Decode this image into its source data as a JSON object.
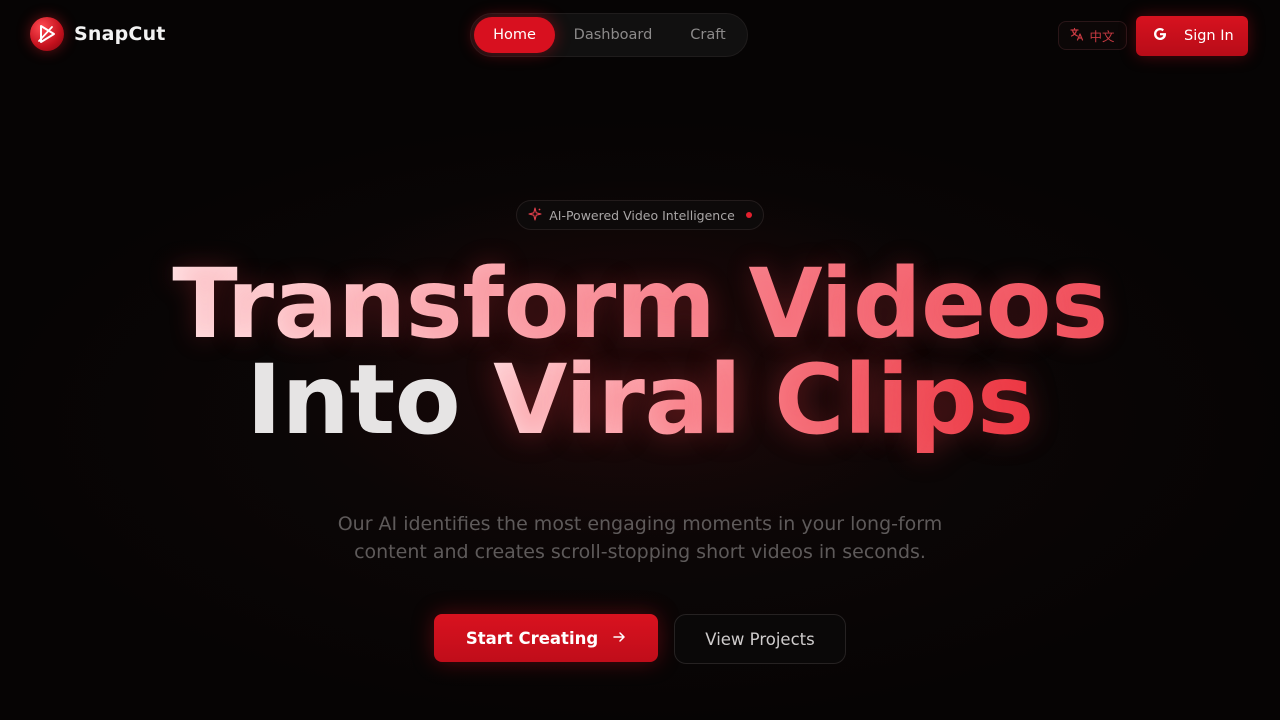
{
  "brand": {
    "name": "SnapCut",
    "logo_icon": "snapcut-logo-icon",
    "accent_color": "#d8101f"
  },
  "nav": {
    "items": [
      {
        "label": "Home",
        "active": true
      },
      {
        "label": "Dashboard",
        "active": false
      },
      {
        "label": "Craft",
        "active": false
      }
    ]
  },
  "header": {
    "language_label": "中文",
    "language_icon": "translate-icon",
    "signin_label": "Sign In",
    "signin_icon": "google-icon"
  },
  "hero": {
    "badge_label": "AI-Powered Video Intelligence",
    "badge_icon": "sparkle-icon",
    "headline": {
      "line1": "Transform Videos",
      "line2_plain": "Into",
      "line2_highlight": "Viral Clips"
    },
    "subtitle": {
      "line1": "Our AI identifies the most engaging moments in your long-form",
      "line2": "content and creates scroll-stopping short videos in seconds."
    },
    "primary_cta": "Start Creating",
    "primary_cta_icon": "arrow-right-icon",
    "secondary_cta": "View Projects"
  }
}
